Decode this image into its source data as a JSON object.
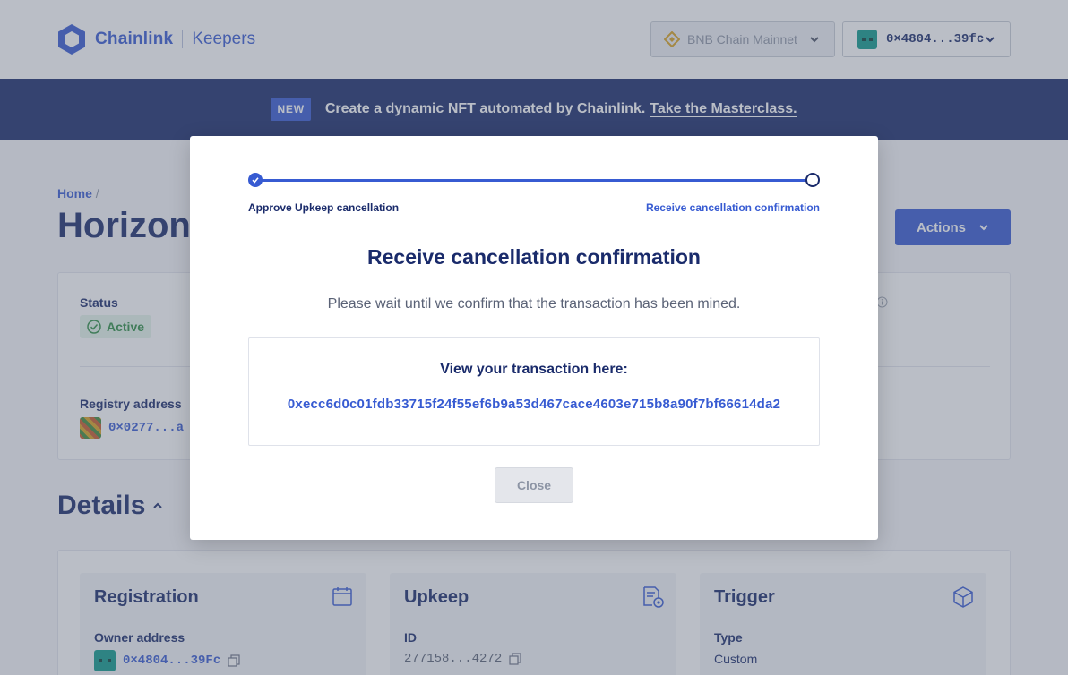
{
  "header": {
    "brand": "Chainlink",
    "product": "Keepers",
    "network": "BNB Chain Mainnet",
    "wallet": "0×4804...39fc"
  },
  "banner": {
    "badge": "NEW",
    "text": "Create a dynamic NFT automated by Chainlink.",
    "link": "Take the Masterclass."
  },
  "page": {
    "breadcrumb_home": "Home",
    "breadcrumb_sep": "/",
    "title": "Horizon",
    "actions": "Actions"
  },
  "summary": {
    "status_label": "Status",
    "status_value": "Active",
    "registry_label": "Registry address",
    "registry_value": "0×0277...a"
  },
  "details": {
    "title": "Details",
    "registration": {
      "title": "Registration",
      "owner_label": "Owner address",
      "owner_value": "0×4804...39Fc"
    },
    "upkeep": {
      "title": "Upkeep",
      "id_label": "ID",
      "id_value": "277158...4272"
    },
    "trigger": {
      "title": "Trigger",
      "type_label": "Type",
      "type_value": "Custom"
    }
  },
  "modal": {
    "step1": "Approve Upkeep cancellation",
    "step2": "Receive cancellation confirmation",
    "title": "Receive cancellation confirmation",
    "description": "Please wait until we confirm that the transaction has been mined.",
    "tx_label": "View your transaction here:",
    "tx_hash": "0xecc6d0c01fdb33715f24f55ef6b9a53d467cace4603e715b8a90f7bf66614da2",
    "close": "Close"
  },
  "colors": {
    "brand_blue": "#375bd2",
    "navy": "#1a2b6b",
    "active_green": "#2f8f46"
  }
}
